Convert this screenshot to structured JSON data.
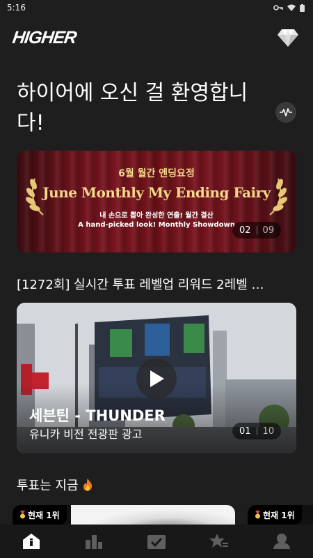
{
  "status_bar": {
    "time": "5:16"
  },
  "header": {
    "logo": "HIGHER",
    "gem_icon": "diamond-icon"
  },
  "welcome": {
    "text": "하이어에 오신 걸 환영합니다!"
  },
  "banner": {
    "kicker": "6월 월간 엔딩요정",
    "title": "June Monthly My Ending Fairy",
    "subtitle_ko": "내 손으로 뽑아 완성한 연출! 월간 결산",
    "subtitle_en": "A hand-picked look! Monthly Showdown",
    "pager": {
      "current": "02",
      "total": "09"
    }
  },
  "section": {
    "title": "[1272회] 실시간 투표 레벨업 리워드 2레벨 …"
  },
  "video": {
    "title": "세븐틴 - THUNDER",
    "subtitle": "유니카 비전 전광판 광고",
    "pager": {
      "current": "01",
      "total": "10"
    }
  },
  "vote_now": {
    "label": "투표는 지금",
    "icon": "fire-icon"
  },
  "rank_cards": [
    {
      "badge": "현재 1위"
    },
    {
      "badge": "현재 1위"
    }
  ],
  "tabbar": {
    "items": [
      {
        "icon": "home-icon",
        "active": true
      },
      {
        "icon": "chart-icon",
        "active": false
      },
      {
        "icon": "vote-check-icon",
        "active": false
      },
      {
        "icon": "favorite-star-icon",
        "active": false
      },
      {
        "icon": "profile-icon",
        "active": false
      }
    ]
  },
  "colors": {
    "background": "#1e1e1e",
    "banner_gold": "#f4d98b",
    "banner_red": "#7a1520",
    "inactive_tab": "#5f5f5f"
  }
}
